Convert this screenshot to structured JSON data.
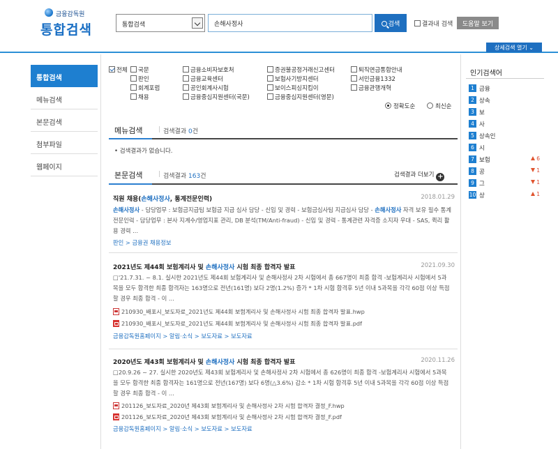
{
  "header": {
    "org_name": "금융감독원",
    "site_title": "통합검색",
    "scope_select": "통합검색",
    "search_value": "손해사정사",
    "search_button": "검색",
    "within_results": "결과내 검색",
    "help_button": "도움말 보기",
    "advanced_button": "상세검색 열기"
  },
  "sidebar": {
    "items": [
      "통합검색",
      "메뉴검색",
      "본문검색",
      "첨부파일",
      "웹페이지"
    ]
  },
  "categories": {
    "all": "전체",
    "col1": [
      "국문",
      "판인",
      "회계포럼",
      "채용"
    ],
    "col2": [
      "금융소비자보호처",
      "금융교육센터",
      "공인회계사시험",
      "금융중심지원센터(국문)"
    ],
    "col3": [
      "증권불공정거래신고센터",
      "보험사기방지센터",
      "보이스피싱지킴이",
      "금융중심지원센터(영문)"
    ],
    "col4": [
      "퇴직연금통합안내",
      "서민금융1332",
      "금융관행개혁"
    ],
    "sort_accuracy": "정확도순",
    "sort_recent": "최신순"
  },
  "menu_section": {
    "title": "메뉴검색",
    "count_label": "검색결과",
    "count": "0",
    "count_unit": "건",
    "no_result": "• 검색결과가 없습니다."
  },
  "body_section": {
    "title": "본문검색",
    "count_label": "검색결과",
    "count": "163",
    "count_unit": "건",
    "more": "검색결과 더보기"
  },
  "results": [
    {
      "title_pre": "직원 채용(",
      "title_hl": "손해사정사",
      "title_post": ", 통계전문인력)",
      "date": "2018.01.29",
      "body_hl": "손해사정사",
      "body_1": " - 담당업무 : 보험금지급팀 보험금 지급 심사 담당 - 신입 및 경력 - 보험금심사팀 지급심사 담당 - ",
      "body_hl2": "손해사정사",
      "body_2": " 자격 보유 필수 통계전문인력 - 담당업무 : 본사 지계수/영업지표 관리, DB 분석(TM/Anti-fraud) - 신입 및 경력 - 통계관련 자격증 소지자 우대 - SAS, 퀵리 활용 경력 ...",
      "crumb": "판인 > 금융권 채용정보"
    },
    {
      "title_pre": "2021년도 제44회 보험계리사 및 ",
      "title_hl": "손해사정사",
      "title_post": " 시험 최종 합격자 발표",
      "date": "2021.09.30",
      "body": "□'21.7.31. ~ 8.1. 실시한 2021년도 제44회 보험계리사 및 손해사정사 2차 시험에서 총 667명이 최종 합격 -보험계리사 시험에서 5과목을 모두 합격한 최종 합격자는 163명으로 전년(161명) 보다 2명(1.2%) 증가 * 1차 시험 합격후 5년 이내 5과목을 각각 60점 이상 득점할 경우 최종 합격 - 이 ...",
      "file_hwp": "210930_배포시_보도자료_2021년도 제44회 보험계리사 및 손해사정사 시험 최종 합격자 발표.hwp",
      "file_pdf": "210930_배포시_보도자료_2021년도 제44회 보험계리사 및 손해사정사 시험 최종 합격자 발표.pdf",
      "crumb": "금융감독원홈페이지 > 알림·소식 > 보도자료 > 보도자료"
    },
    {
      "title_pre": "2020년도 제43회 보험계리사 및 ",
      "title_hl": "손해사정사",
      "title_post": " 시험 최종 합격자 발표",
      "date": "2020.11.26",
      "body": "□20.9.26 ~ 27. 실시한 2020년도 제43회 보험계리사 및 손해사정사 2차 시험에서 총 626명이 최종 합격 -보험계리사 시험에서 5과목을 모두 합격한 최종 합격자는 161명으로 전년(167명) 보다 6명(△3.6%) 감소 * 1차 시험 합격후 5년 이내 5과목을 각각 60점 이상 득점할 경우 최종 합격 - 이 ...",
      "file_hwp": "201126_보도자료_2020년 제43회 보험계리사 및 손해사정사 2차 시험 합격자 결정_F.hwp",
      "file_pdf": "201126_보도자료_2020년 제43회 보험계리사 및 손해사정사 2차 시험 합격자 결정_F.pdf",
      "crumb": "금융감독원홈페이지 > 알림·소식 > 보도자료 > 보도자료"
    }
  ],
  "popular": {
    "title": "인기검색어",
    "items": [
      {
        "rank": "1",
        "word": "금융",
        "change": ""
      },
      {
        "rank": "2",
        "word": "상속",
        "change": ""
      },
      {
        "rank": "3",
        "word": "보",
        "change": ""
      },
      {
        "rank": "4",
        "word": "사",
        "change": ""
      },
      {
        "rank": "5",
        "word": "상속인",
        "change": ""
      },
      {
        "rank": "6",
        "word": "시",
        "change": ""
      },
      {
        "rank": "7",
        "word": "보험",
        "change": "6",
        "dir": "up"
      },
      {
        "rank": "8",
        "word": "공",
        "change": "1",
        "dir": "down"
      },
      {
        "rank": "9",
        "word": "그",
        "change": "1",
        "dir": "down"
      },
      {
        "rank": "10",
        "word": "상",
        "change": "1",
        "dir": "up"
      }
    ]
  }
}
